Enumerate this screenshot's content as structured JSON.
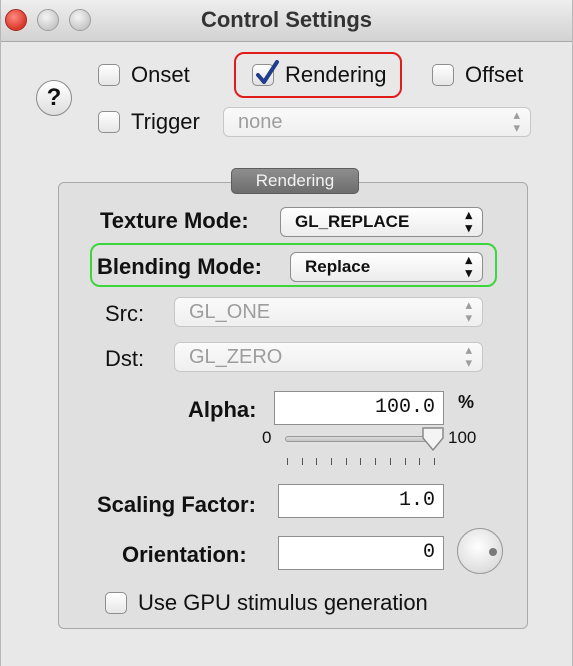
{
  "window": {
    "title": "Control Settings"
  },
  "top": {
    "help_label": "?",
    "onset": {
      "label": "Onset",
      "checked": false
    },
    "rendering": {
      "label": "Rendering",
      "checked": true
    },
    "offset": {
      "label": "Offset",
      "checked": false
    },
    "trigger": {
      "label": "Trigger",
      "checked": false,
      "value": "none"
    }
  },
  "rendering_group": {
    "title": "Rendering",
    "texture_mode": {
      "label": "Texture Mode:",
      "value": "GL_REPLACE"
    },
    "blending_mode": {
      "label": "Blending Mode:",
      "value": "Replace"
    },
    "src": {
      "label": "Src:",
      "value": "GL_ONE"
    },
    "dst": {
      "label": "Dst:",
      "value": "GL_ZERO"
    },
    "alpha": {
      "label": "Alpha:",
      "value": "100.0",
      "unit": "%",
      "slider_min": "0",
      "slider_max": "100",
      "slider_value": 100
    },
    "scaling_factor": {
      "label": "Scaling Factor:",
      "value": "1.0"
    },
    "orientation": {
      "label": "Orientation:",
      "value": "0"
    },
    "use_gpu": {
      "label": "Use GPU stimulus generation",
      "checked": false
    }
  },
  "highlights": {
    "red": "#e21b1b",
    "green": "#3bd63b"
  }
}
